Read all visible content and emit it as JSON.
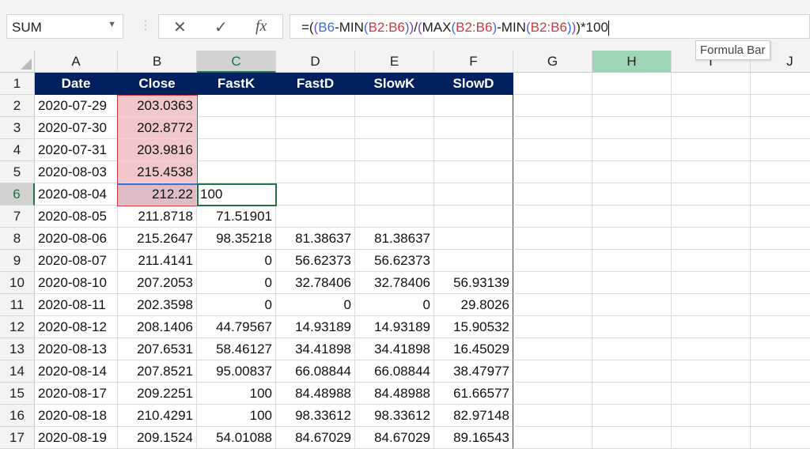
{
  "name_box": "SUM",
  "formula_bar": {
    "cancel_icon": "x-icon",
    "enter_icon": "check-icon",
    "fx_label": "fx",
    "parts": [
      {
        "t": "=(",
        "c": ""
      },
      {
        "t": "(",
        "c": "p1"
      },
      {
        "t": "B6",
        "c": "ref1"
      },
      {
        "t": "-MIN",
        "c": ""
      },
      {
        "t": "(",
        "c": "p2"
      },
      {
        "t": "B2:B6",
        "c": "ref2"
      },
      {
        "t": ")",
        "c": "p2"
      },
      {
        "t": ")",
        "c": "p1"
      },
      {
        "t": "/",
        "c": ""
      },
      {
        "t": "(",
        "c": "p1"
      },
      {
        "t": "MAX",
        "c": ""
      },
      {
        "t": "(",
        "c": "p2"
      },
      {
        "t": "B2:B6",
        "c": "ref2"
      },
      {
        "t": ")",
        "c": "p2"
      },
      {
        "t": "-MIN",
        "c": ""
      },
      {
        "t": "(",
        "c": "p2"
      },
      {
        "t": "B2:B6",
        "c": "ref2"
      },
      {
        "t": ")",
        "c": "p2"
      },
      {
        "t": ")",
        "c": "p1"
      },
      {
        "t": ")*100",
        "c": ""
      }
    ]
  },
  "tooltip": "Formula Bar",
  "columns": [
    "A",
    "B",
    "C",
    "D",
    "E",
    "F",
    "G",
    "H",
    "I",
    "J"
  ],
  "header_row": [
    "Date",
    "Close",
    "FastK",
    "FastD",
    "SlowK",
    "SlowD"
  ],
  "rows": [
    [
      "2020-07-29",
      "203.0363",
      "",
      "",
      "",
      ""
    ],
    [
      "2020-07-30",
      "202.8772",
      "",
      "",
      "",
      ""
    ],
    [
      "2020-07-31",
      "203.9816",
      "",
      "",
      "",
      ""
    ],
    [
      "2020-08-03",
      "215.4538",
      "",
      "",
      "",
      ""
    ],
    [
      "2020-08-04",
      "212.22",
      "100",
      "",
      "",
      ""
    ],
    [
      "2020-08-05",
      "211.8718",
      "71.51901",
      "",
      "",
      ""
    ],
    [
      "2020-08-06",
      "215.2647",
      "98.35218",
      "81.38637",
      "81.38637",
      ""
    ],
    [
      "2020-08-07",
      "211.4141",
      "0",
      "56.62373",
      "56.62373",
      ""
    ],
    [
      "2020-08-10",
      "207.2053",
      "0",
      "32.78406",
      "32.78406",
      "56.93139"
    ],
    [
      "2020-08-11",
      "202.3598",
      "0",
      "0",
      "0",
      "29.8026"
    ],
    [
      "2020-08-12",
      "208.1406",
      "44.79567",
      "14.93189",
      "14.93189",
      "15.90532"
    ],
    [
      "2020-08-13",
      "207.6531",
      "58.46127",
      "34.41898",
      "34.41898",
      "16.45029"
    ],
    [
      "2020-08-14",
      "207.8521",
      "95.00837",
      "66.08844",
      "66.08844",
      "38.47977"
    ],
    [
      "2020-08-17",
      "209.2251",
      "100",
      "84.48988",
      "84.48988",
      "61.66577"
    ],
    [
      "2020-08-18",
      "210.4291",
      "100",
      "98.33612",
      "98.33612",
      "82.97148"
    ],
    [
      "2020-08-19",
      "209.1524",
      "54.01088",
      "84.67029",
      "84.67029",
      "89.16543"
    ]
  ],
  "colors": {
    "header_fill": "#002060",
    "range_fill": "#f2c7cb",
    "active_border": "#217346"
  }
}
